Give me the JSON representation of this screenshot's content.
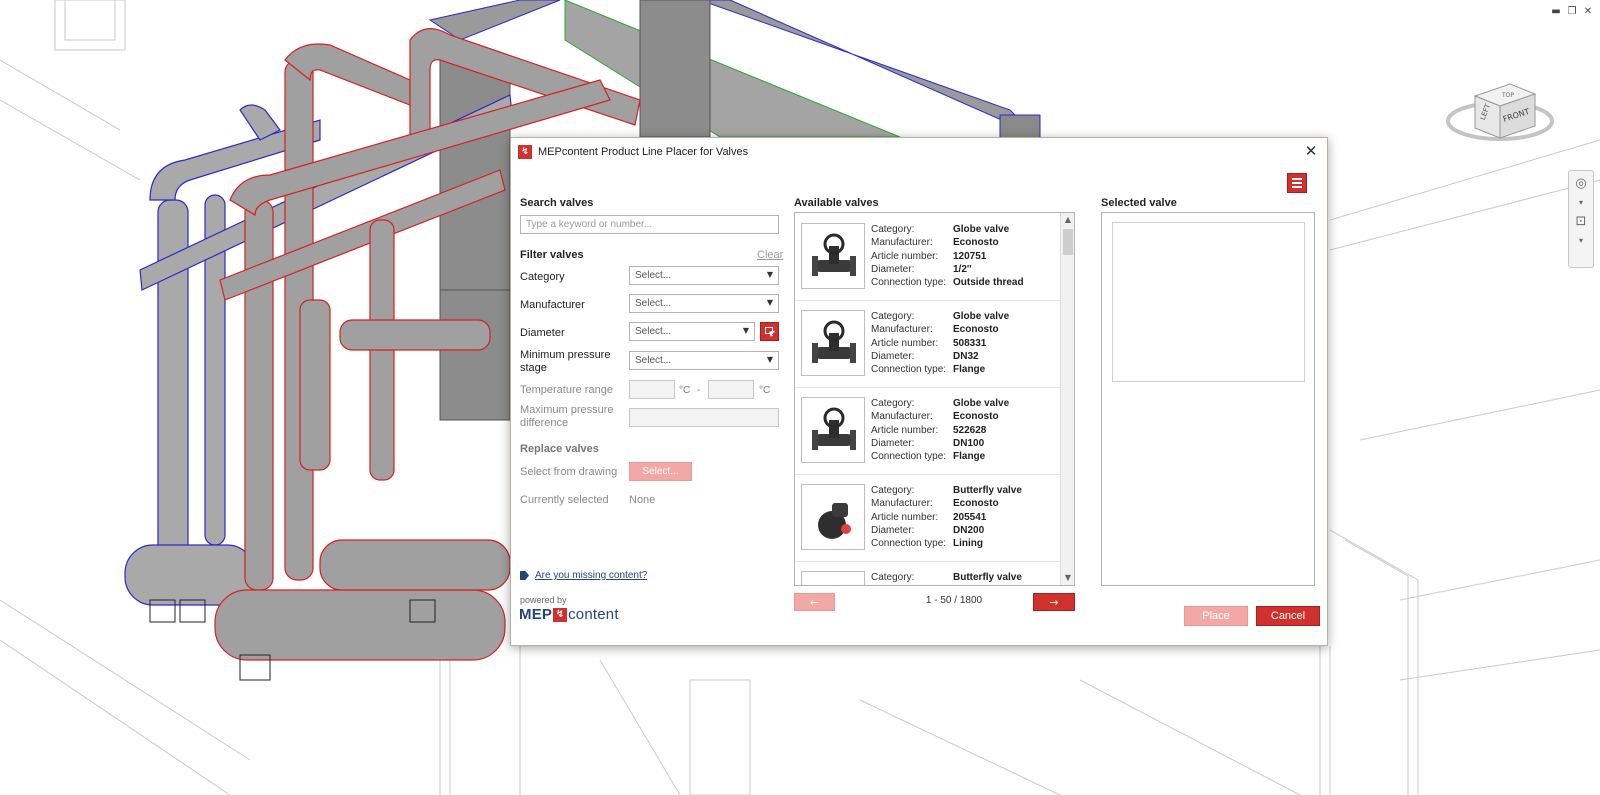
{
  "window_controls": {
    "minimize": "▬",
    "restore": "❐",
    "close": "✕"
  },
  "viewcube": {
    "left": "LEFT",
    "front": "FRONT",
    "top": "TOP"
  },
  "dialog": {
    "title": "MEPcontent Product Line Placer for Valves",
    "close": "✕"
  },
  "search": {
    "heading": "Search valves",
    "placeholder": "Type a keyword or number..."
  },
  "filter": {
    "heading": "Filter valves",
    "clear": "Clear",
    "category_label": "Category",
    "category_value": "Select...",
    "manufacturer_label": "Manufacturer",
    "manufacturer_value": "Select...",
    "diameter_label": "Diameter",
    "diameter_value": "Select...",
    "min_pressure_label_1": "Minimum pressure",
    "min_pressure_label_2": "stage",
    "min_pressure_value": "Select...",
    "temperature_label": "Temperature range",
    "temp_unit": "°C",
    "temp_dash": "-",
    "max_pressure_label_1": "Maximum pressure",
    "max_pressure_label_2": "difference"
  },
  "replace": {
    "heading": "Replace valves",
    "select_label": "Select from drawing",
    "select_button": "Select...",
    "current_label": "Currently selected",
    "current_value": "None"
  },
  "missing_link": "Are you missing content?",
  "powered_by": "powered by",
  "brand": {
    "a": "MEP",
    "mark": "↯",
    "b": "content"
  },
  "available": {
    "heading": "Available valves",
    "field_labels": {
      "category": "Category:",
      "manufacturer": "Manufacturer:",
      "article": "Article number:",
      "diameter": "Diameter:",
      "connection": "Connection type:"
    },
    "items": [
      {
        "category": "Globe valve",
        "manufacturer": "Econosto",
        "article": "120751",
        "diameter": "1/2''",
        "connection": "Outside thread"
      },
      {
        "category": "Globe valve",
        "manufacturer": "Econosto",
        "article": "508331",
        "diameter": "DN32",
        "connection": "Flange"
      },
      {
        "category": "Globe valve",
        "manufacturer": "Econosto",
        "article": "522628",
        "diameter": "DN100",
        "connection": "Flange"
      },
      {
        "category": "Butterfly valve",
        "manufacturer": "Econosto",
        "article": "205541",
        "diameter": "DN200",
        "connection": "Lining"
      },
      {
        "category": "Butterfly valve"
      }
    ],
    "pager": "1 - 50 / 1800",
    "prev": "←",
    "next": "→"
  },
  "selected": {
    "heading": "Selected valve"
  },
  "buttons": {
    "place": "Place",
    "cancel": "Cancel"
  },
  "colors": {
    "accent_red": "#d0312d",
    "disabled_red": "#f1a8a6",
    "link_blue": "#24457c"
  }
}
